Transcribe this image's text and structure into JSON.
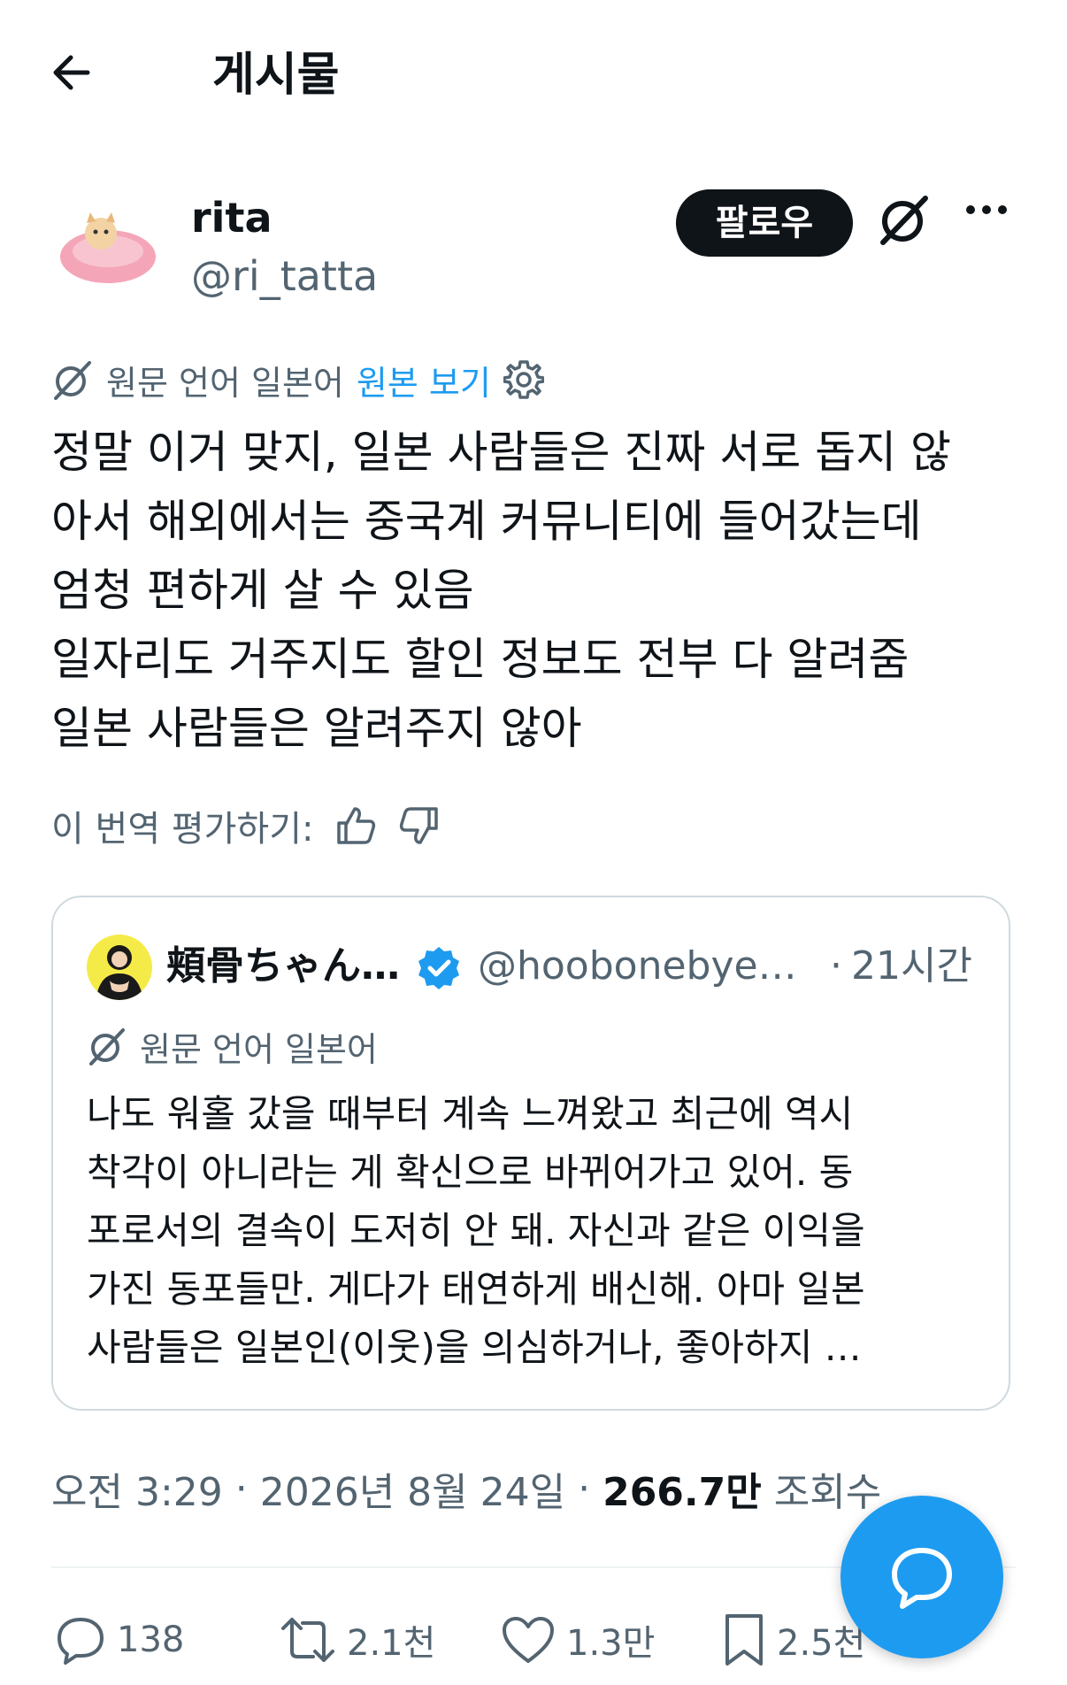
{
  "header": {
    "title": "게시물"
  },
  "post": {
    "author_name": "rita",
    "author_handle": "@ri_tatta",
    "follow_label": "팔로우",
    "translation_source": "원문 언어 일본어",
    "view_original": "원본 보기",
    "text": "정말 이거 맞지, 일본 사람들은 진짜 서로 돕지 않\n아서 해외에서는 중국계 커뮤니티에 들어갔는데\n엄청 편하게 살 수 있음\n일자리도 거주지도 할인 정보도 전부 다 알려줌\n일본 사람들은 알려주지 않아",
    "rate_label": "이 번역 평가하기:",
    "time": "오전 3:29",
    "date": "2026년 8월 24일",
    "views_count": "266.7만",
    "views_label": "조회수"
  },
  "quote": {
    "author_name": "頬骨ちゃん…",
    "author_handle": "@hoobonebye…",
    "separator": "·",
    "time": "21시간",
    "translation_source": "원문 언어 일본어",
    "text": "나도 워홀 갔을 때부터 계속 느껴왔고 최근에 역시\n착각이 아니라는 게 확신으로 바뀌어가고 있어. 동\n포로서의 결속이 도저히 안 돼. 자신과 같은 이익을\n가진 동포들만. 게다가 태연하게 배신해. 아마 일본\n사람들은 일본인(이웃)을 의심하거나, 좋아하지 …"
  },
  "actions": {
    "replies": "138",
    "reposts": "2.1천",
    "likes": "1.3만",
    "bookmarks": "2.5천"
  },
  "colors": {
    "accent": "#1d9bf0",
    "text": "#0f1419",
    "secondary": "#536471",
    "border": "#cfd9de"
  }
}
